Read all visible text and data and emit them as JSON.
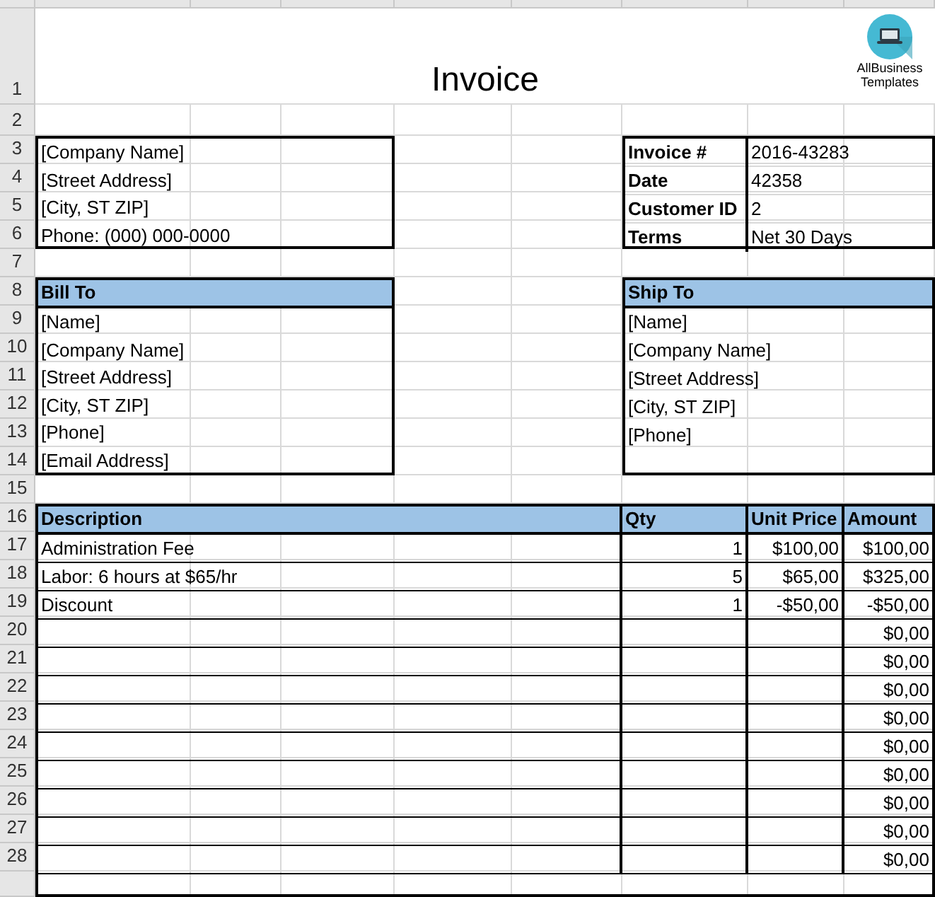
{
  "title": "Invoice",
  "logo": {
    "text": "AllBusiness Templates"
  },
  "row_numbers": [
    "1",
    "2",
    "3",
    "4",
    "5",
    "6",
    "7",
    "8",
    "9",
    "10",
    "11",
    "12",
    "13",
    "14",
    "15",
    "16",
    "17",
    "18",
    "19",
    "20",
    "21",
    "22",
    "23",
    "24",
    "25",
    "26",
    "27",
    "28"
  ],
  "company": [
    "[Company Name]",
    "[Street Address]",
    "[City, ST ZIP]",
    "Phone: (000) 000-0000"
  ],
  "invoice_info": [
    {
      "label": "Invoice #",
      "value": "2016-43283"
    },
    {
      "label": "Date",
      "value": "42358"
    },
    {
      "label": "Customer ID",
      "value": "2"
    },
    {
      "label": "Terms",
      "value": "Net 30 Days"
    }
  ],
  "bill_to": {
    "heading": "Bill To",
    "lines": [
      "[Name]",
      "[Company Name]",
      "[Street Address]",
      "[City, ST ZIP]",
      "[Phone]",
      "[Email Address]"
    ]
  },
  "ship_to": {
    "heading": "Ship To",
    "lines": [
      "[Name]",
      "[Company Name]",
      "[Street Address]",
      "[City, ST ZIP]",
      "[Phone]"
    ]
  },
  "items": {
    "columns": [
      "Description",
      "Qty",
      "Unit Price",
      "Amount"
    ],
    "rows": [
      {
        "description": "Administration Fee",
        "qty": "1",
        "unit_price": "$100,00",
        "amount": "$100,00"
      },
      {
        "description": "Labor: 6 hours at $65/hr",
        "qty": "5",
        "unit_price": "$65,00",
        "amount": "$325,00"
      },
      {
        "description": "Discount",
        "qty": "1",
        "unit_price": "-$50,00",
        "amount": "-$50,00"
      },
      {
        "amount": "$0,00"
      },
      {
        "amount": "$0,00"
      },
      {
        "amount": "$0,00"
      },
      {
        "amount": "$0,00"
      },
      {
        "amount": "$0,00"
      },
      {
        "amount": "$0,00"
      },
      {
        "amount": "$0,00"
      },
      {
        "amount": "$0,00"
      },
      {
        "amount": "$0,00"
      }
    ]
  }
}
